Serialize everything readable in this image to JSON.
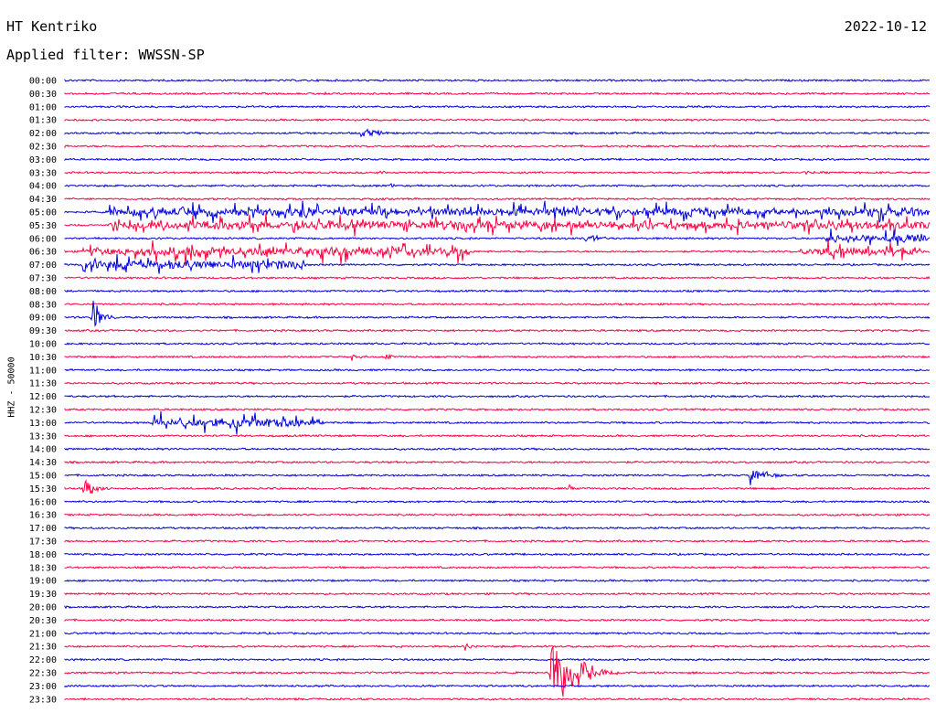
{
  "header": {
    "station": "HT Kentriko",
    "date": "2022-10-12",
    "filter": "Applied filter: WWSSN-SP"
  },
  "channel_label": "HHZ - 50000",
  "colors": {
    "blue": "#0000dd",
    "red": "#ff0040"
  },
  "chart_data": {
    "type": "line",
    "title": "HT Kentriko",
    "ylabel": "HHZ - 50000",
    "row_labels": [
      "00:00",
      "00:30",
      "01:00",
      "01:30",
      "02:00",
      "02:30",
      "03:00",
      "03:30",
      "04:00",
      "04:30",
      "05:00",
      "05:30",
      "06:00",
      "06:30",
      "07:00",
      "07:30",
      "08:00",
      "08:30",
      "09:00",
      "09:30",
      "10:00",
      "10:30",
      "11:00",
      "11:30",
      "12:00",
      "12:30",
      "13:00",
      "13:30",
      "14:00",
      "14:30",
      "15:00",
      "15:30",
      "16:00",
      "16:30",
      "17:00",
      "17:30",
      "18:00",
      "18:30",
      "19:00",
      "19:30",
      "20:00",
      "20:30",
      "21:00",
      "21:30",
      "22:00",
      "22:30",
      "23:00",
      "23:30"
    ],
    "events": [
      {
        "row": 1,
        "x": 0.3,
        "amp": 3,
        "dur": 0.01
      },
      {
        "row": 4,
        "x": 0.34,
        "amp": 7,
        "dur": 0.07
      },
      {
        "row": 7,
        "x": 0.36,
        "amp": 3,
        "dur": 0.05
      },
      {
        "row": 7,
        "x": 0.85,
        "amp": 3,
        "dur": 0.06
      },
      {
        "row": 8,
        "x": 0.37,
        "amp": 5,
        "dur": 0.03
      },
      {
        "row": 10,
        "x": 0.05,
        "amp": 14,
        "dur": 0.95,
        "burst": true
      },
      {
        "row": 11,
        "x": 0.05,
        "amp": 14,
        "dur": 0.95,
        "burst": true
      },
      {
        "row": 12,
        "x": 0.6,
        "amp": 8,
        "dur": 0.05
      },
      {
        "row": 12,
        "x": 0.88,
        "amp": 14,
        "dur": 0.12,
        "burst": true
      },
      {
        "row": 13,
        "x": 0.02,
        "amp": 16,
        "dur": 0.45,
        "burst": true
      },
      {
        "row": 13,
        "x": 0.85,
        "amp": 14,
        "dur": 0.14,
        "burst": true
      },
      {
        "row": 14,
        "x": 0.02,
        "amp": 14,
        "dur": 0.26,
        "burst": true
      },
      {
        "row": 18,
        "x": 0.03,
        "amp": 30,
        "dur": 0.03
      },
      {
        "row": 21,
        "x": 0.33,
        "amp": 6,
        "dur": 0.03
      },
      {
        "row": 21,
        "x": 0.37,
        "amp": 6,
        "dur": 0.03
      },
      {
        "row": 26,
        "x": 0.1,
        "amp": 14,
        "dur": 0.2,
        "burst": true
      },
      {
        "row": 29,
        "x": 0.78,
        "amp": 6,
        "dur": 0.01
      },
      {
        "row": 30,
        "x": 0.79,
        "amp": 16,
        "dur": 0.05
      },
      {
        "row": 31,
        "x": 0.02,
        "amp": 16,
        "dur": 0.04
      },
      {
        "row": 31,
        "x": 0.58,
        "amp": 10,
        "dur": 0.02
      },
      {
        "row": 43,
        "x": 0.46,
        "amp": 10,
        "dur": 0.02
      },
      {
        "row": 45,
        "x": 0.56,
        "amp": 60,
        "dur": 0.08
      }
    ]
  }
}
